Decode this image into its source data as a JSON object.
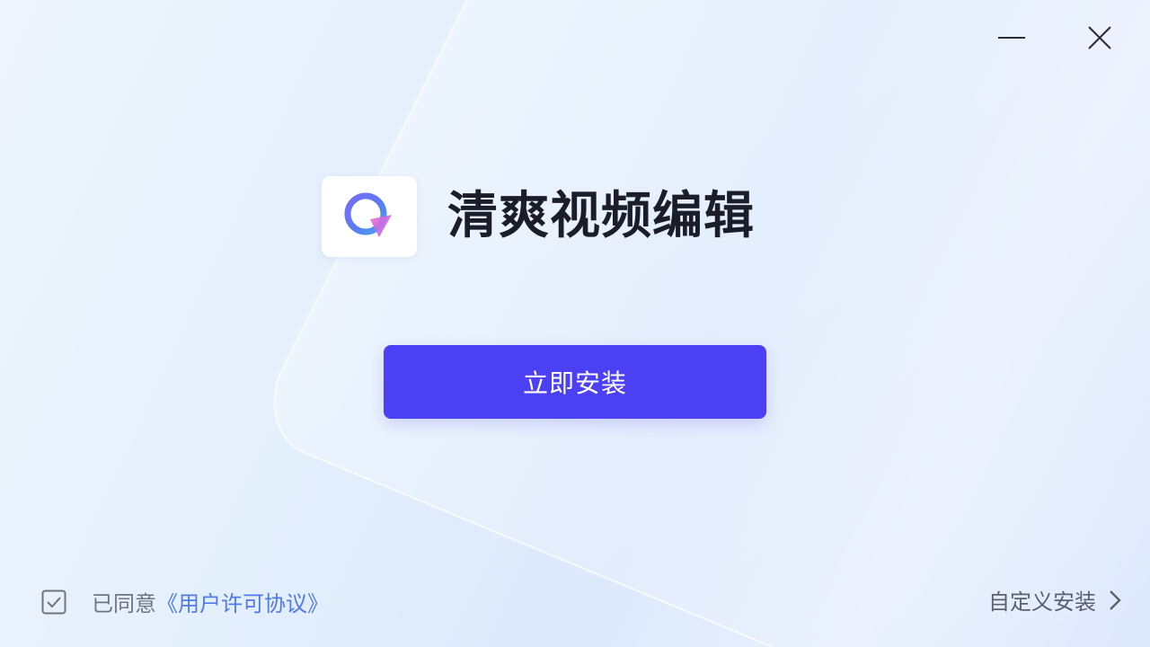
{
  "window": {
    "minimize_icon": "minimize-icon",
    "close_icon": "close-icon"
  },
  "app": {
    "name": "清爽视频编辑",
    "logo_icon": "app-logo-icon"
  },
  "install": {
    "label": "立即安装"
  },
  "agreement": {
    "checked": true,
    "prefix": "已同意",
    "link_text": "《用户许可协议》"
  },
  "custom_install": {
    "label": "自定义安装",
    "icon": "chevron-right-icon"
  },
  "colors": {
    "accent": "#4b40f4",
    "link": "#4f7ae8",
    "title": "#1b1d2b"
  }
}
